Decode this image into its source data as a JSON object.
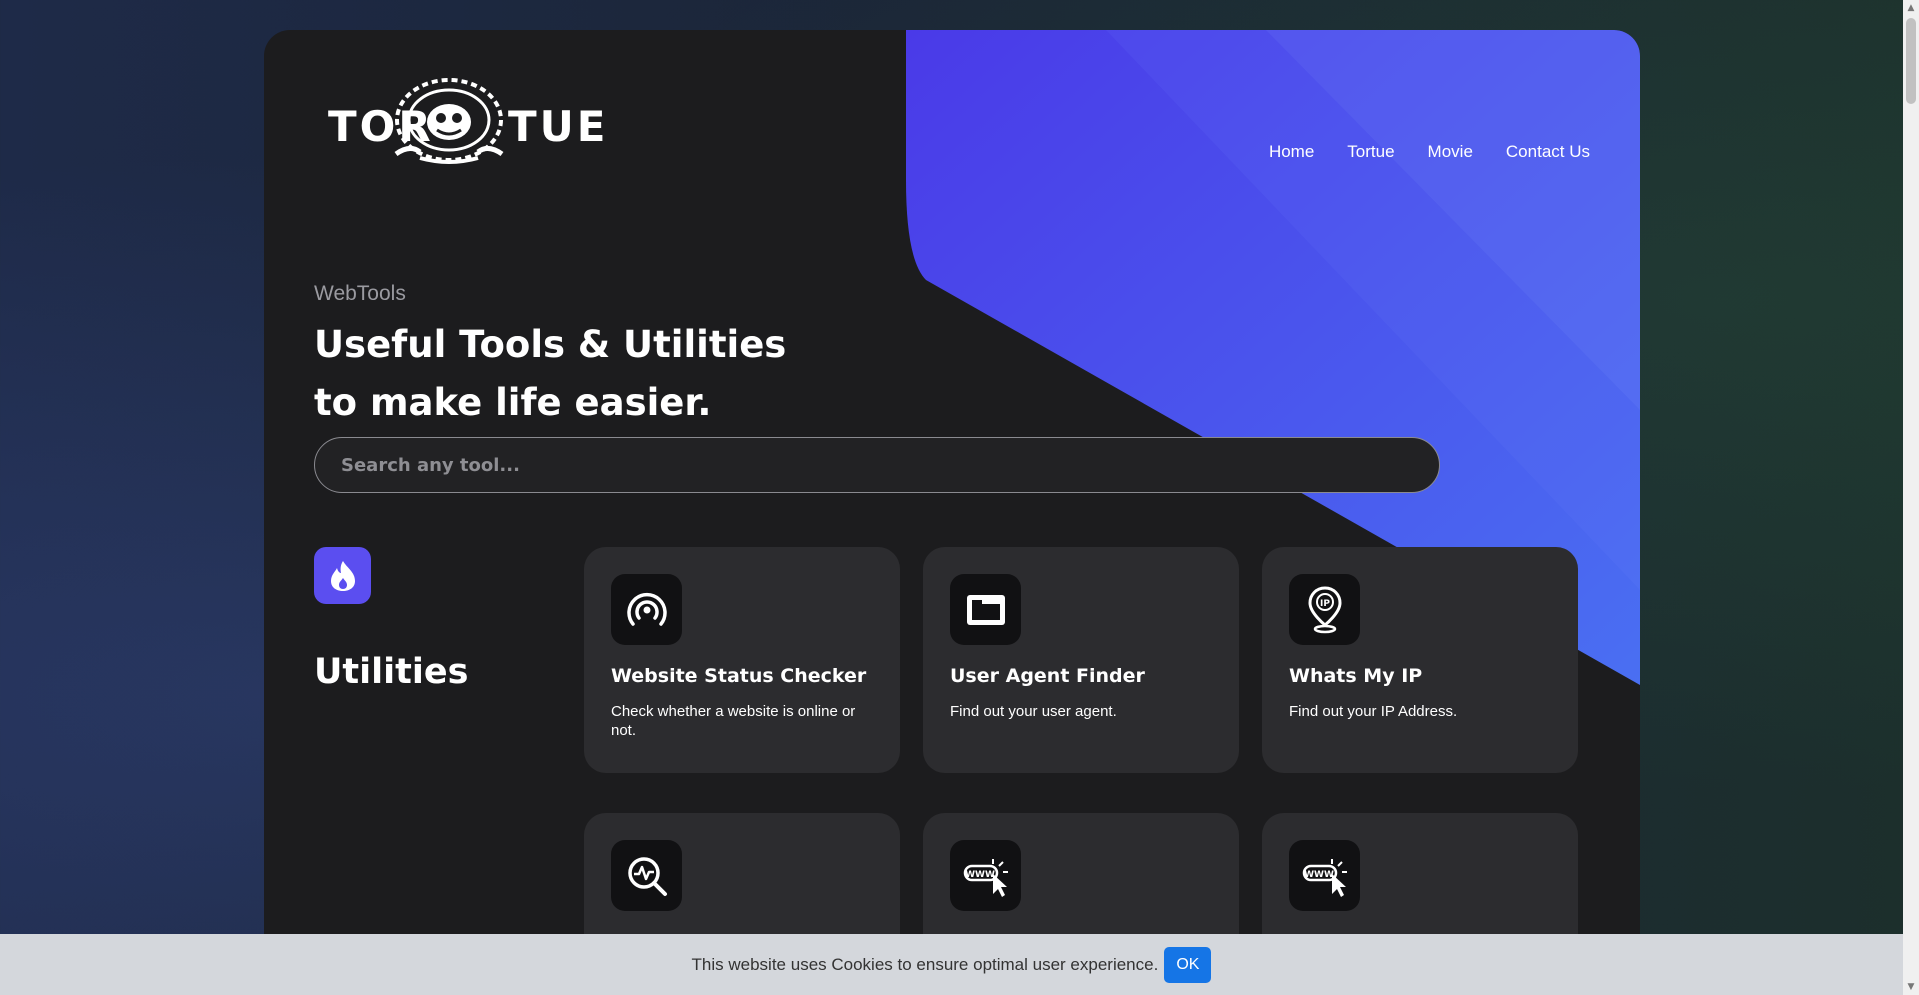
{
  "brand": {
    "logo_text_left": "TOR",
    "logo_text_right": "TUE"
  },
  "nav": {
    "items": [
      {
        "label": "Home"
      },
      {
        "label": "Tortue"
      },
      {
        "label": "Movie"
      },
      {
        "label": "Contact Us"
      }
    ]
  },
  "hero": {
    "eyebrow": "WebTools",
    "title_line1": "Useful Tools & Utilities",
    "title_line2": "to make life easier."
  },
  "search": {
    "placeholder": "Search any tool..."
  },
  "section": {
    "title": "Utilities",
    "icon": "flame-icon"
  },
  "tools": [
    {
      "name": "Website Status Checker",
      "desc": "Check whether a website is online or not.",
      "icon": "broadcast-icon"
    },
    {
      "name": "User Agent Finder",
      "desc": "Find out your user agent.",
      "icon": "browser-window-icon"
    },
    {
      "name": "Whats My IP",
      "desc": "Find out your IP Address.",
      "icon": "ip-location-pin-icon"
    },
    {
      "name": "",
      "desc": "",
      "icon": "search-activity-icon"
    },
    {
      "name": "",
      "desc": "",
      "icon": "www-cursor-icon"
    },
    {
      "name": "",
      "desc": "",
      "icon": "www-cursor-icon"
    }
  ],
  "cookie": {
    "text": "This website uses Cookies to ensure optimal user experience.",
    "button": "OK"
  },
  "colors": {
    "accent": "#5b4ef0",
    "card_bg": "#1c1c1e",
    "tile_bg": "#2c2c2f",
    "cookie_button": "#1575e6"
  }
}
